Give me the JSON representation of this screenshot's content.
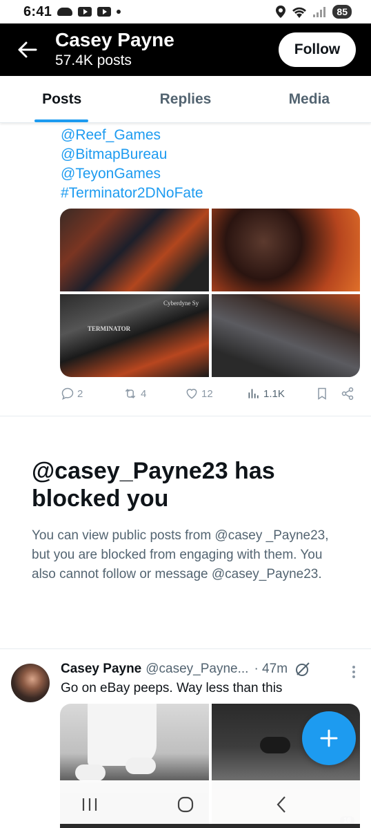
{
  "status_bar": {
    "time": "6:41",
    "battery": "85",
    "icons": [
      "cloud-icon",
      "youtube-icon",
      "youtube-icon",
      "dot-icon",
      "location-icon",
      "wifi-icon",
      "signal-icon"
    ]
  },
  "profile": {
    "name": "Casey Payne",
    "posts_count": "57.4K posts",
    "follow_label": "Follow"
  },
  "tabs": [
    {
      "label": "Posts",
      "active": true
    },
    {
      "label": "Replies",
      "active": false
    },
    {
      "label": "Media",
      "active": false
    }
  ],
  "tweet1": {
    "links": [
      "@Reef_Games",
      "@BitmapBureau",
      "@TeyonGames",
      "#Terminator2DNoFate"
    ],
    "image_labels": [
      "Cyberdyne Sy",
      "TERMINATOR"
    ],
    "stats": {
      "replies": "2",
      "reposts": "4",
      "likes": "12",
      "views": "1.1K"
    }
  },
  "blocked": {
    "title": "@casey_Payne23 has blocked you",
    "body": "You can view public posts from @casey _Payne23, but you are blocked from engaging with them. You also cannot follow or message @casey_Payne23."
  },
  "tweet2": {
    "name": "Casey Payne",
    "handle": "@casey_Payne...",
    "time": "· 47m",
    "text": "Go on eBay peeps. Way less than this",
    "image_badge": "16"
  },
  "colors": {
    "accent": "#1d9bf0",
    "header_bg": "#000000",
    "muted_text": "#536471"
  }
}
